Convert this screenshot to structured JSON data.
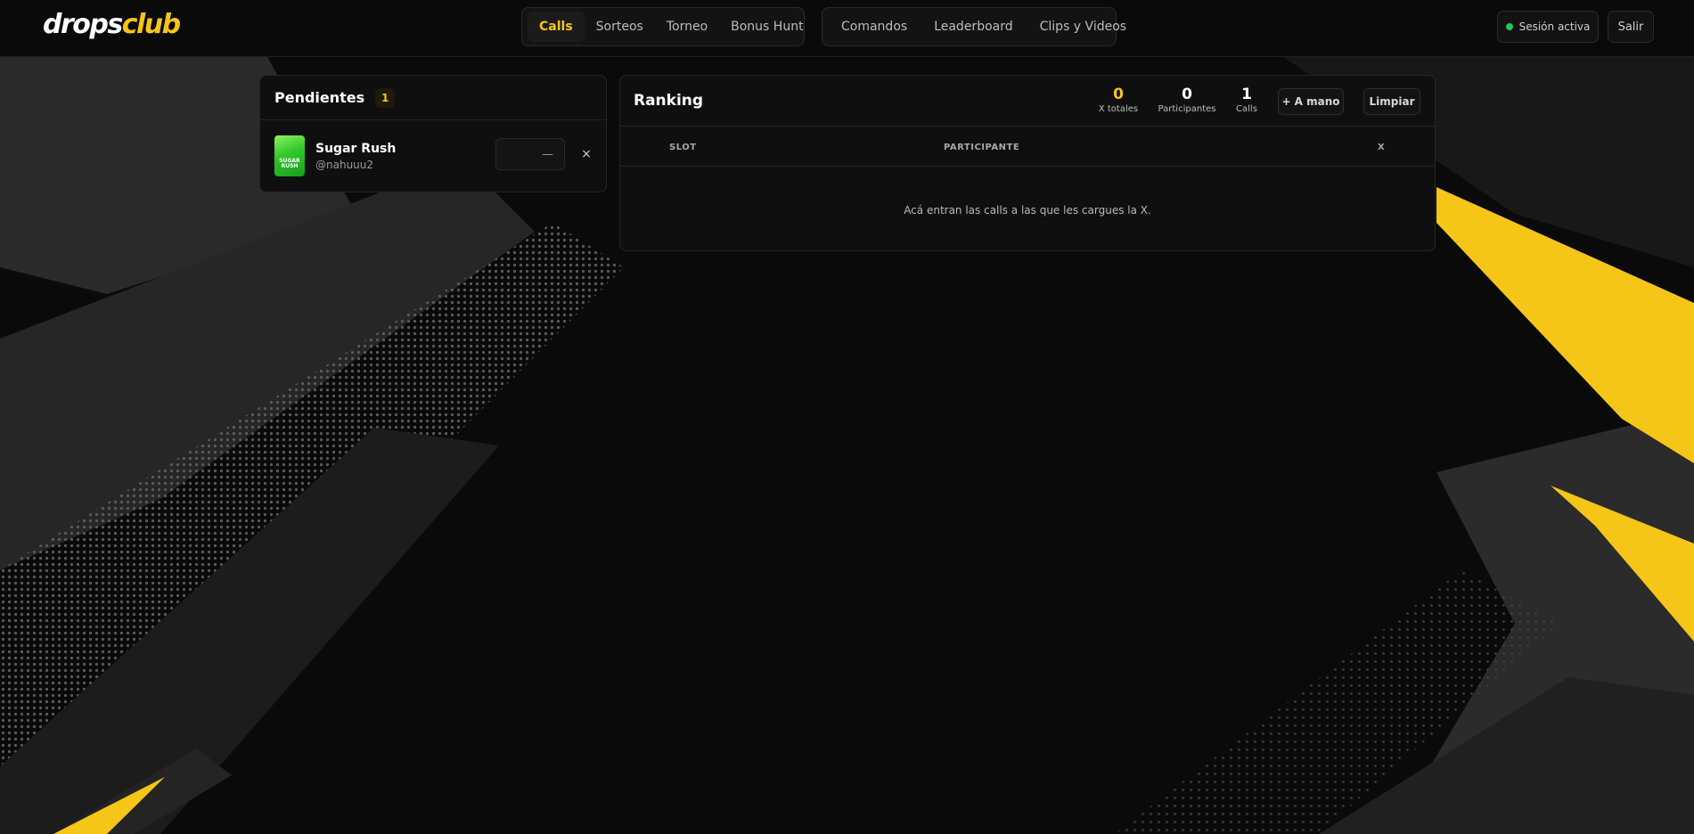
{
  "brand": {
    "name_main": "drops",
    "name_accent": "club"
  },
  "nav_primary": [
    {
      "label": "Calls",
      "active": true
    },
    {
      "label": "Sorteos",
      "active": false
    },
    {
      "label": "Torneo",
      "active": false
    },
    {
      "label": "Bonus Hunt",
      "active": false
    }
  ],
  "nav_secondary": [
    {
      "label": "Comandos"
    },
    {
      "label": "Leaderboard"
    },
    {
      "label": "Clips y Videos"
    }
  ],
  "session": {
    "status_label": "Sesión activa",
    "logout_label": "Salir"
  },
  "pending": {
    "title": "Pendientes",
    "count": "1",
    "items": [
      {
        "game": "Sugar Rush",
        "user": "@nahuuu2",
        "thumb_text": "SUGAR RUSH",
        "multiplier_placeholder": "—",
        "remove_label": "×"
      }
    ]
  },
  "ranking": {
    "title": "Ranking",
    "stats": {
      "x_totales": {
        "value": "0",
        "label": "X totales"
      },
      "participantes": {
        "value": "0",
        "label": "Participantes"
      },
      "calls": {
        "value": "1",
        "label": "Calls"
      }
    },
    "add_manual_label": "+ A mano",
    "clear_label": "Limpiar",
    "columns": [
      "SLOT",
      "PARTICIPANTE",
      "X"
    ],
    "empty_text": "Acá entran las calls a las que les cargues la X."
  },
  "colors": {
    "accent": "#f5c518",
    "status_online": "#22c55e",
    "panel_bg": "#0f0f10"
  }
}
